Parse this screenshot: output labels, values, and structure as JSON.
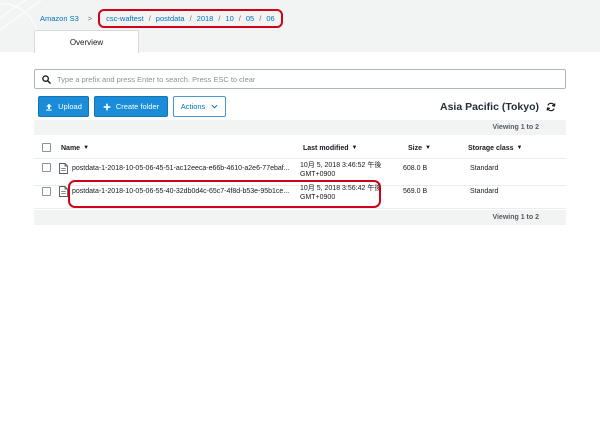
{
  "breadcrumb": {
    "root": "Amazon S3",
    "caret": ">",
    "segments": [
      "csc-waftest",
      "postdata",
      "2018",
      "10",
      "05",
      "06"
    ],
    "separator": "/"
  },
  "tabs": [
    {
      "label": "Overview",
      "active": true
    }
  ],
  "search": {
    "value": "",
    "placeholder": "Type a prefix and press Enter to search. Press ESC to clear",
    "icon": "search-icon"
  },
  "toolbar": {
    "upload_label": "Upload",
    "upload_icon": "upload-icon",
    "create_folder_label": "Create folder",
    "create_folder_icon": "plus-icon",
    "actions_label": "Actions",
    "actions_icon": "chevron-down-icon"
  },
  "region": {
    "label": "Asia Pacific (Tokyo)",
    "refresh_icon": "refresh-icon"
  },
  "viewing": {
    "top": "Viewing 1 to 2",
    "bottom": "Viewing 1 to 2"
  },
  "table": {
    "columns": [
      {
        "label": "Name",
        "sort": "▼"
      },
      {
        "label": "Last modified",
        "sort": "▼"
      },
      {
        "label": "Size",
        "sort": "▼"
      },
      {
        "label": "Storage class",
        "sort": "▼"
      }
    ],
    "rows": [
      {
        "name": "postdata-1-2018-10-05-06-45-51-ac12eeca-e66b-4610-a2e6-77ebaf...",
        "modified_line1": "10月 5, 2018 3:46:52 午後",
        "modified_line2": "GMT+0900",
        "size": "608.0 B",
        "storage_class": "Standard"
      },
      {
        "name": "postdata-1-2018-10-05-06-55-40-32db0d4c-65c7-4f8d-b53e-95b1ce...",
        "modified_line1": "10月 5, 2018 3:56:42 午後",
        "modified_line2": "GMT+0900",
        "size": "569.0 B",
        "storage_class": "Standard"
      }
    ]
  },
  "colors": {
    "link": "#0073bb",
    "primary_button": "#1a8cd8",
    "highlight": "#d0021b",
    "band": "#f2f3f3"
  }
}
